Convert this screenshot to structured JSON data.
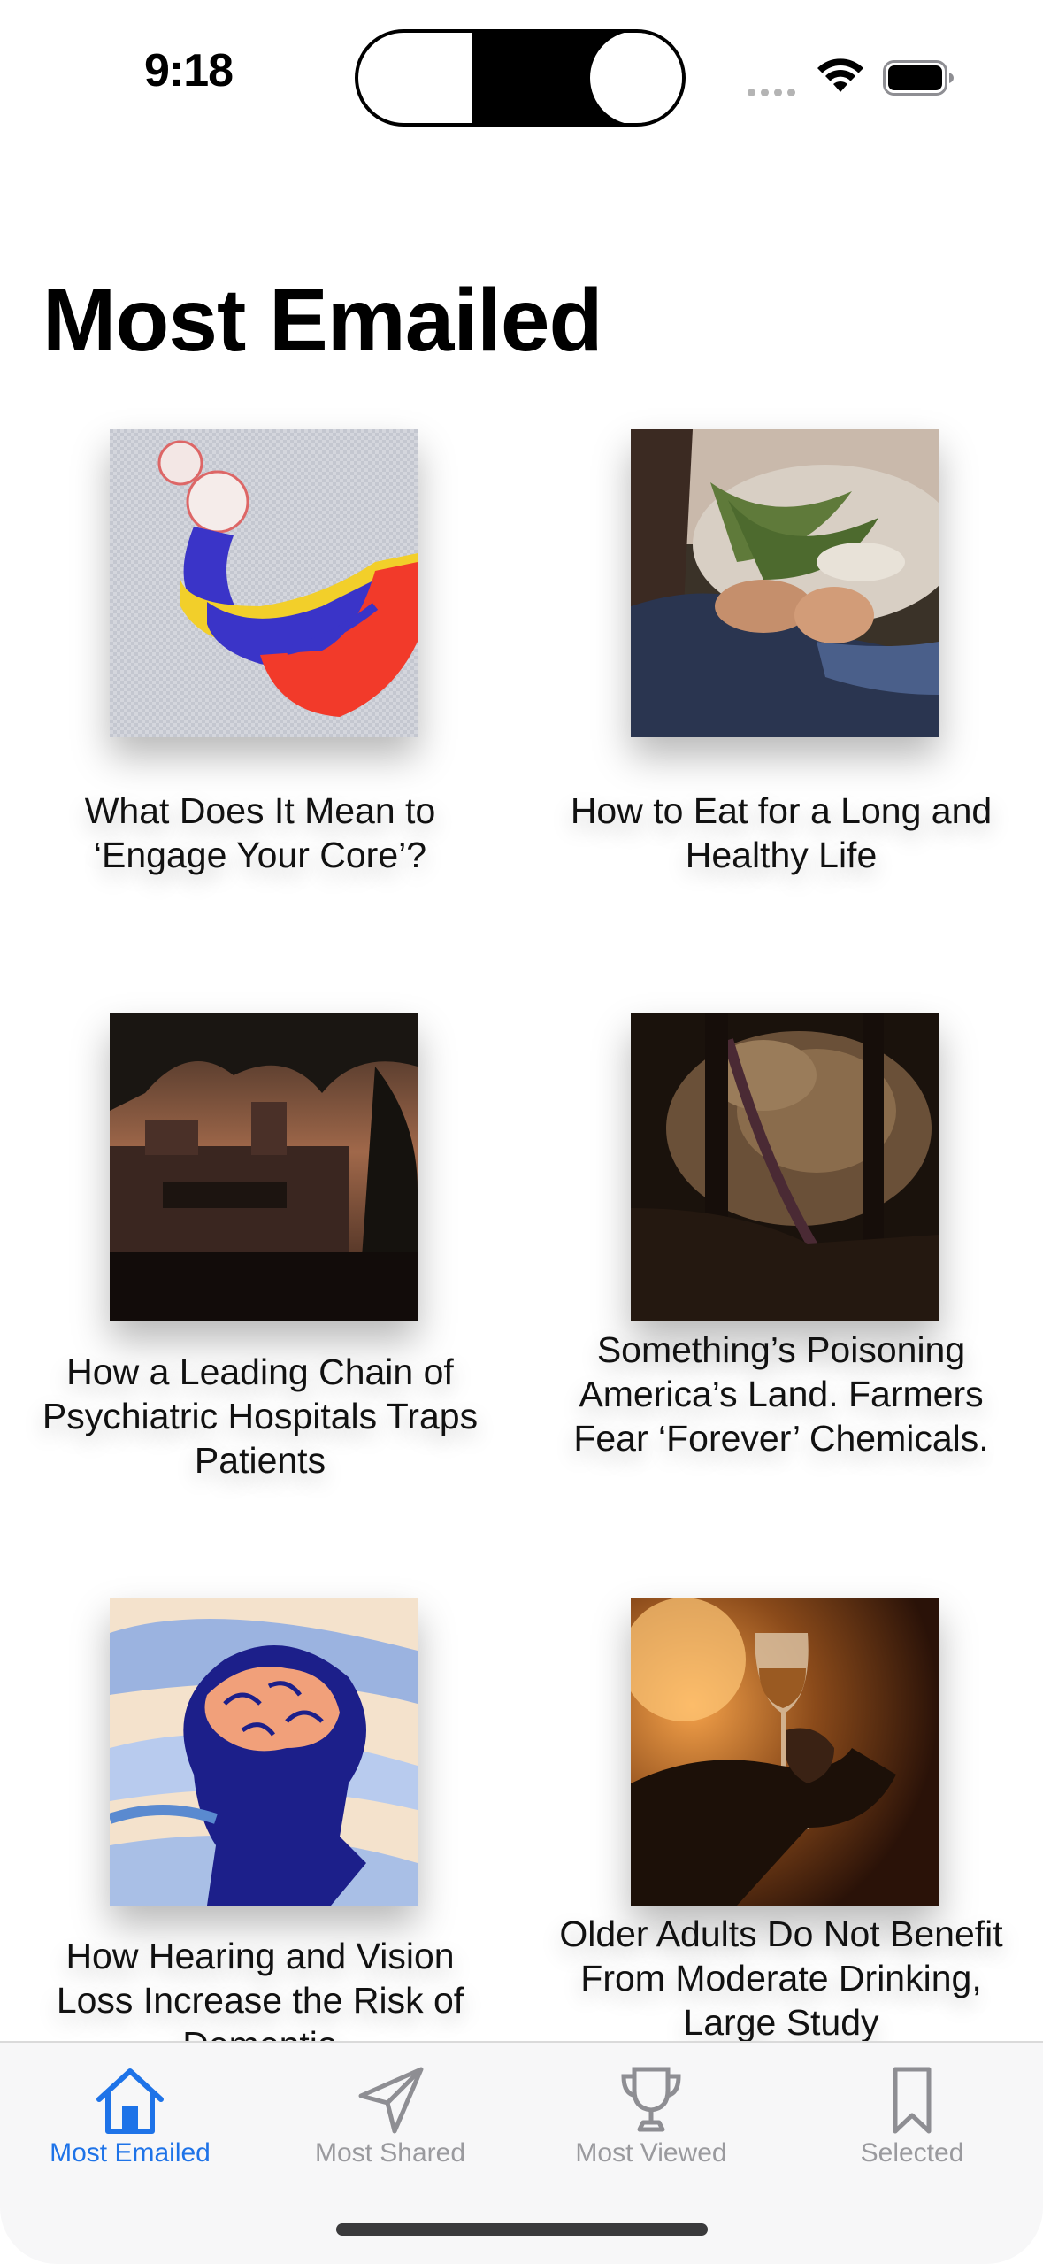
{
  "status": {
    "time": "9:18"
  },
  "page": {
    "title": "Most Emailed"
  },
  "articles": [
    {
      "headline": "What Does It Mean to ‘Engage Your Core’?"
    },
    {
      "headline": "How to Eat for a Long and Healthy Life"
    },
    {
      "headline": "How a Leading Chain of Psychiatric Hospitals Traps Patients"
    },
    {
      "headline": "Something’s Poisoning America’s Land. Farmers Fear ‘Forever’ Chemicals."
    },
    {
      "headline": "How Hearing and Vision Loss Increase the Risk of Dementia"
    },
    {
      "headline": "Older Adults Do Not Benefit From Moderate Drinking, Large Study"
    }
  ],
  "tabs": [
    {
      "label": "Most Emailed",
      "icon": "house-icon",
      "active": true
    },
    {
      "label": "Most Shared",
      "icon": "paper-plane-icon",
      "active": false
    },
    {
      "label": "Most Viewed",
      "icon": "trophy-icon",
      "active": false
    },
    {
      "label": "Selected",
      "icon": "bookmark-icon",
      "active": false
    }
  ],
  "colors": {
    "accent": "#1e73e8",
    "inactive": "#9a9a9e",
    "background": "#ffffff"
  }
}
